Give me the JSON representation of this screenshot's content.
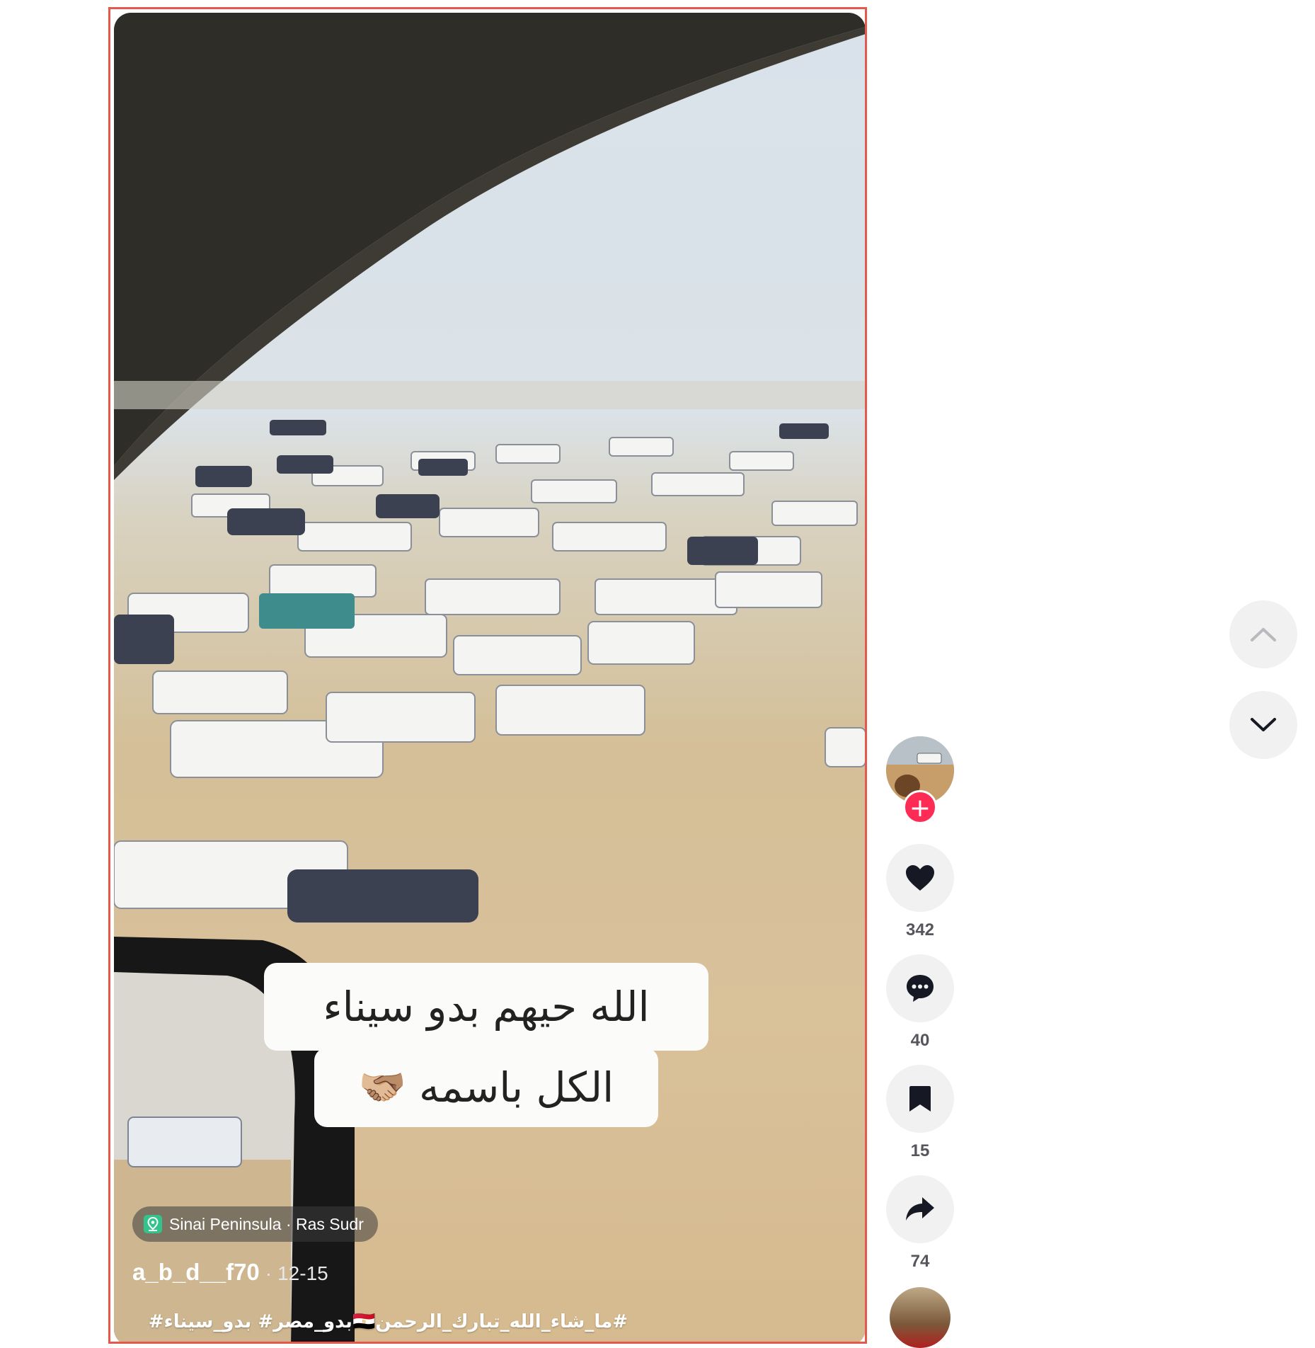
{
  "video": {
    "overlay_caption": {
      "line1": "الله حيهم بدو سيناء",
      "line2": "الكل باسمه",
      "line2_emoji": "🫱🏼‍🫲🏽"
    },
    "location": "Sinai Peninsula · Ras Sudr",
    "author": "a_b_d__f70",
    "date_separator": "·",
    "date": "12-15",
    "description": "#ما_شاء_الله_تبارك_الرحمن🇪🇬بدو_مصر# بدو_سيناء#"
  },
  "actions": {
    "likes": "342",
    "comments": "40",
    "saves": "15",
    "shares": "74"
  },
  "icons": {
    "follow": "plus-icon",
    "like": "heart-icon",
    "comment": "comment-bubble-icon",
    "save": "bookmark-icon",
    "share": "share-arrow-icon",
    "prev": "chevron-up-icon",
    "next": "chevron-down-icon",
    "location": "location-pin-icon"
  },
  "follow_symbol": "+",
  "colors": {
    "accent": "#fe2c55",
    "frame_border": "#e5584c",
    "button_bg": "#f1f1f2",
    "count_text": "#55565c"
  }
}
